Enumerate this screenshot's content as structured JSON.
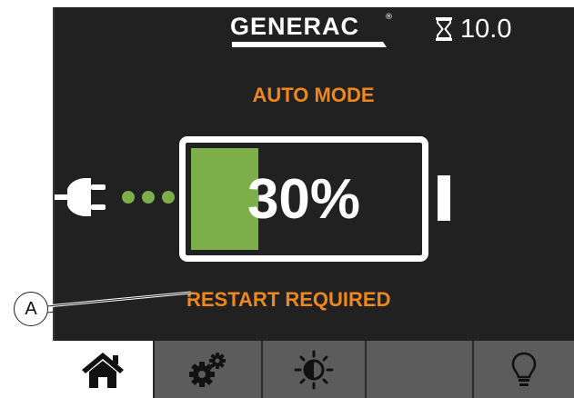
{
  "header": {
    "brand": "GENERAC",
    "brand_mark": "®",
    "timer_icon": "hourglass-icon",
    "timer_value": "10.0"
  },
  "main": {
    "mode": "AUTO MODE",
    "plug_icon": "power-plug-icon",
    "battery_percent_label": "30%",
    "battery_level_fraction": 0.3,
    "status": "RESTART REQUIRED"
  },
  "callout": {
    "label": "A"
  },
  "nav": {
    "buttons": [
      {
        "name": "home",
        "icon": "home-icon",
        "active": true
      },
      {
        "name": "settings",
        "icon": "gears-icon",
        "active": false
      },
      {
        "name": "brightness",
        "icon": "brightness-icon",
        "active": false
      },
      {
        "name": "blank",
        "icon": "",
        "active": false
      },
      {
        "name": "tips",
        "icon": "lightbulb-icon",
        "active": false
      }
    ]
  },
  "colors": {
    "background": "#212121",
    "accent_orange": "#f0871e",
    "battery_green": "#7cae4a",
    "nav_active": "#ffffff",
    "nav_inactive": "#5c5c5c"
  }
}
